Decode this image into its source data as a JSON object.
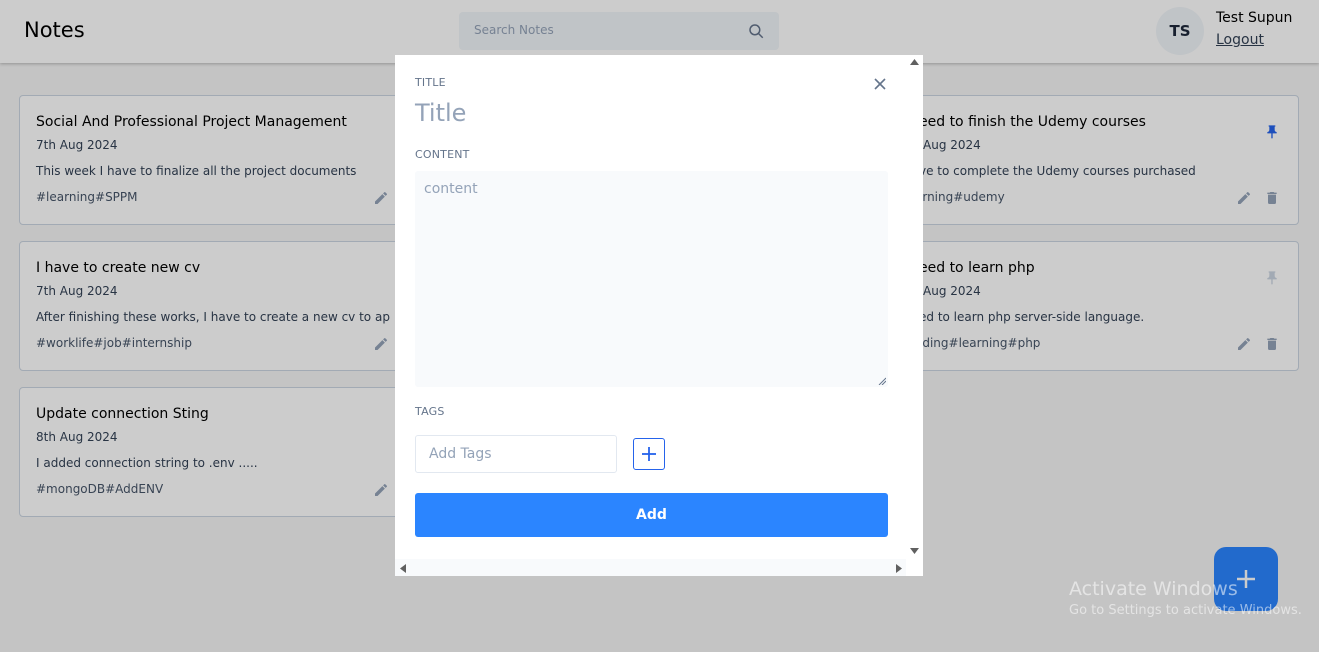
{
  "navbar": {
    "brand": "Notes",
    "search_placeholder": "Search Notes",
    "user_initials": "TS",
    "user_name": "Test Supun",
    "logout_label": "Logout"
  },
  "notes": [
    {
      "title": "Social And Professional Project Management",
      "date": "7th Aug 2024",
      "content": "This week I have to finalize all the project documents",
      "tags": "#learning#SPPM"
    },
    {
      "title": "I have to create new cv",
      "date": "7th Aug 2024",
      "content": "After finishing these works, I have to create a new cv to ap",
      "tags": "#worklife#job#internship"
    },
    {
      "title": "Update connection Sting",
      "date": "8th Aug 2024",
      "content": "I added connection string to .env .....",
      "tags": "#mongoDB#AddENV"
    },
    {
      "title": "eed to finish the Udemy courses",
      "date": "Aug 2024",
      "content": "ve to complete the Udemy courses purchased",
      "tags": "arning#udemy"
    },
    {
      "title": "eed to learn php",
      "date": "Aug 2024",
      "content": "ed to learn php server-side language.",
      "tags": "oding#learning#php"
    }
  ],
  "modal": {
    "title_label": "TITLE",
    "title_placeholder": "Title",
    "content_label": "CONTENT",
    "content_placeholder": "content",
    "tags_label": "TAGS",
    "tags_placeholder": "Add Tags",
    "add_label": "Add"
  },
  "watermark": {
    "line1": "Activate Windows",
    "line2": "Go to Settings to activate Windows."
  },
  "colors": {
    "primary": "#2b85ff",
    "pin_active": "#2563eb",
    "icon_muted": "#94a3b8"
  }
}
